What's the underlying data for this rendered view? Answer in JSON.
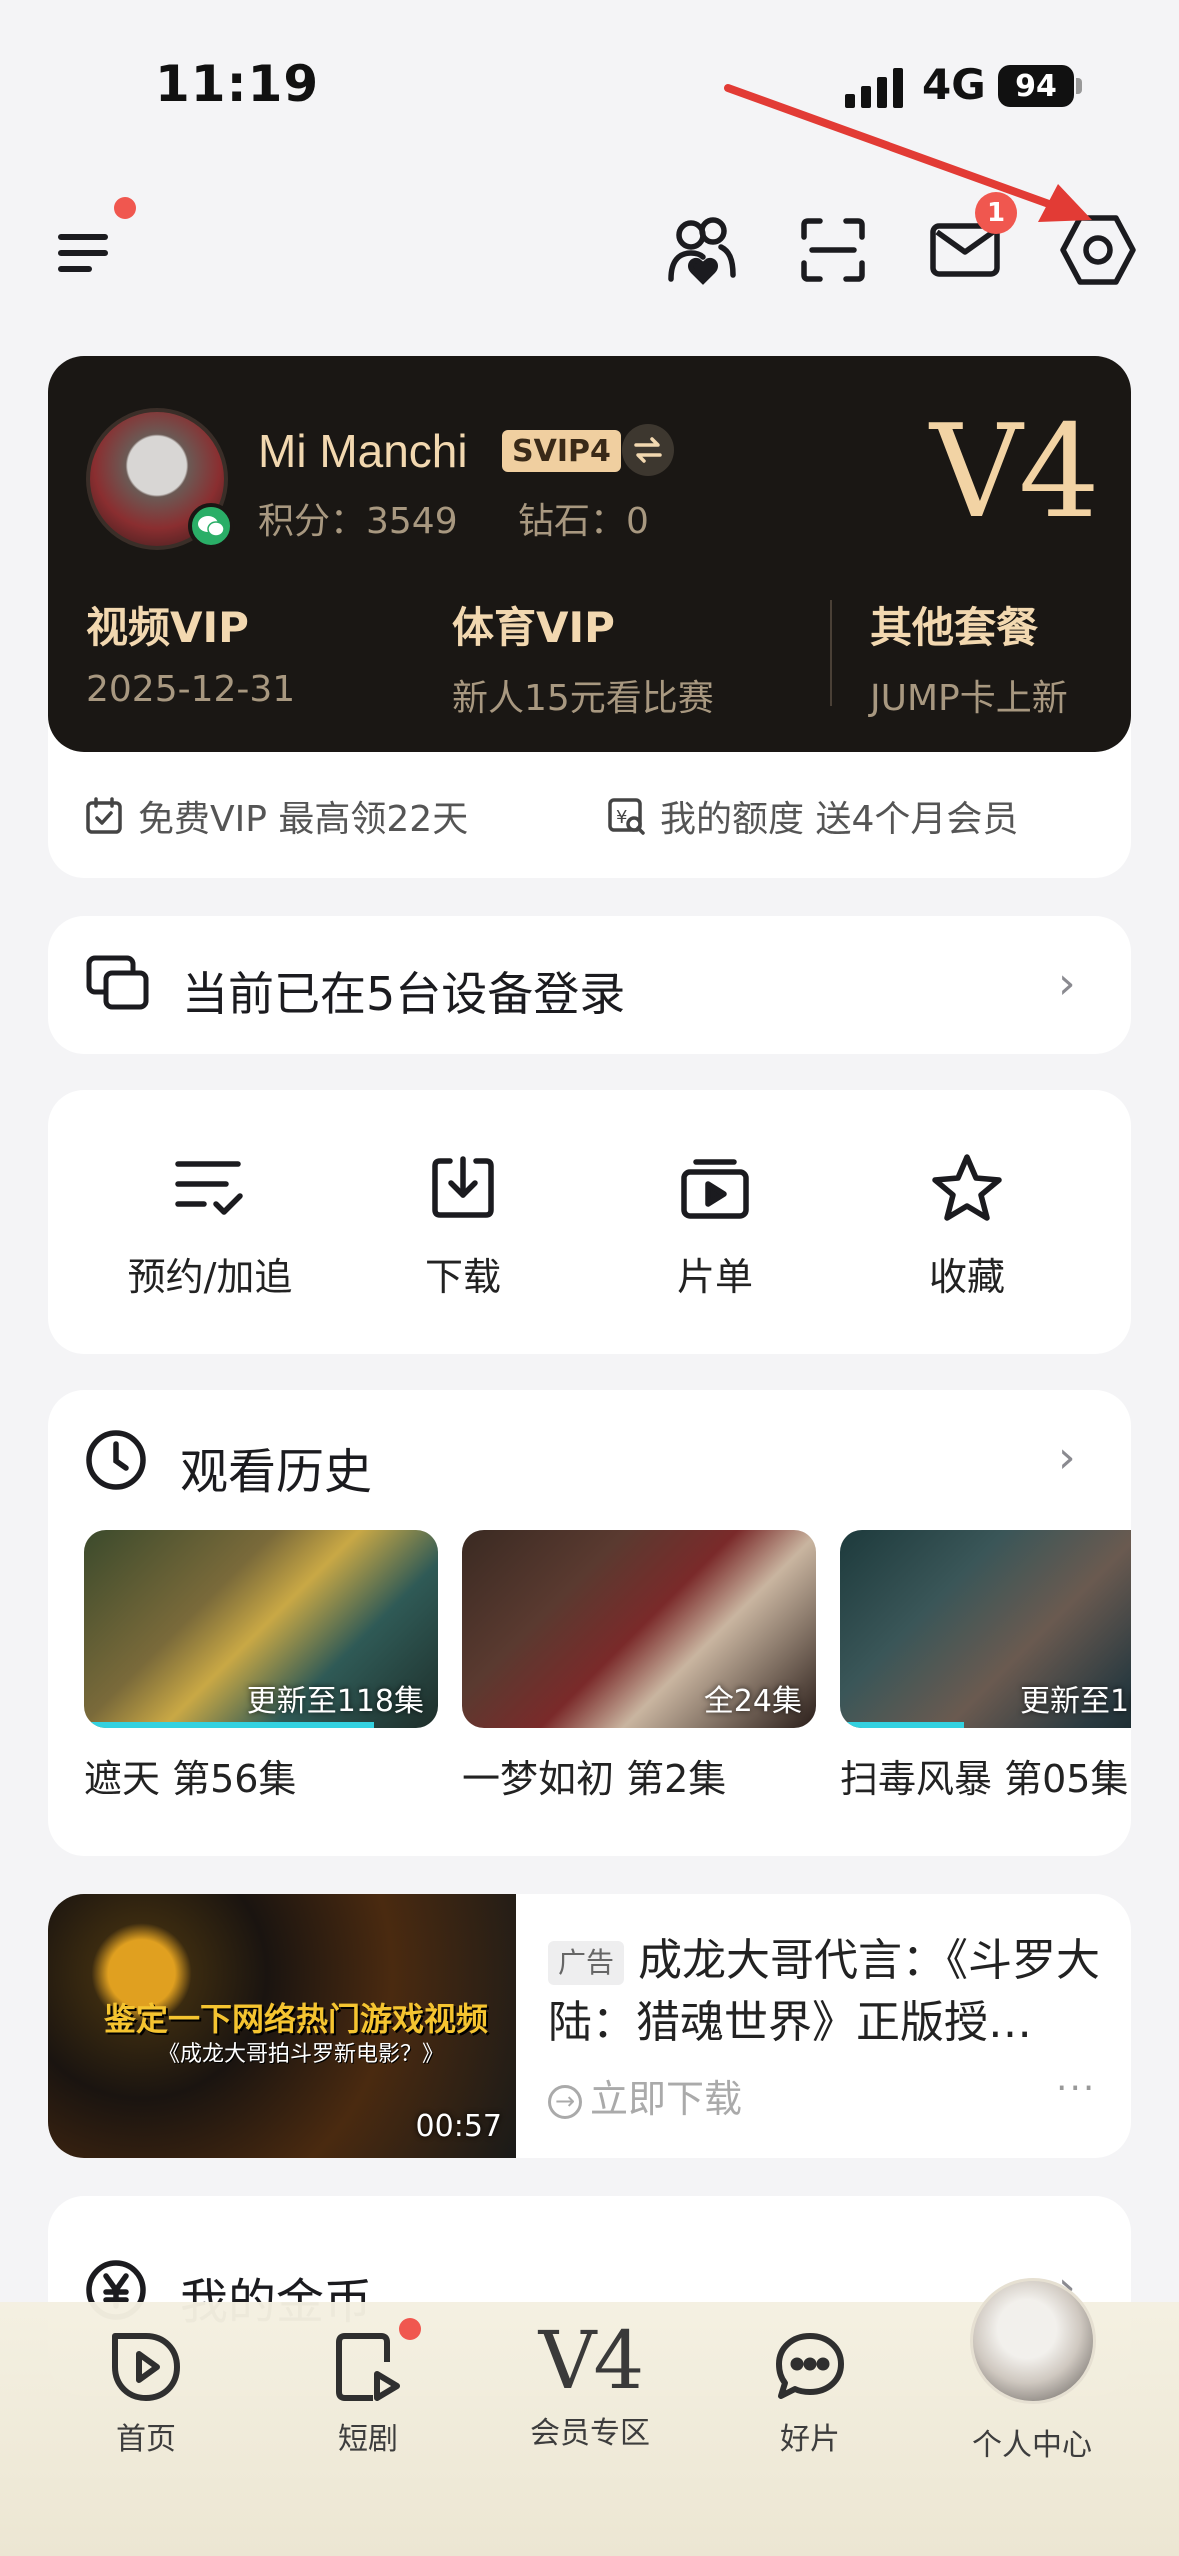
{
  "status_bar": {
    "time": "11:19",
    "network": "4G",
    "battery": "94"
  },
  "toolbar": {
    "messages_badge": "1"
  },
  "vip_card": {
    "user_name": "Mi Manchi",
    "vip_tag": "SVIP4",
    "points": "积分：3549",
    "diamonds": "钻石：0",
    "level": "V4",
    "plans": [
      {
        "title": "视频VIP",
        "subtitle": "2025-12-31"
      },
      {
        "title": "体育VIP",
        "subtitle": "新人15元看比赛"
      },
      {
        "title": "其他套餐",
        "subtitle": "JUMP卡上新"
      }
    ],
    "free_vip": "免费VIP 最高领22天",
    "my_quota": "我的额度 送4个月会员"
  },
  "devices": {
    "text": "当前已在5台设备登录"
  },
  "actions": [
    {
      "label": "预约/加追",
      "icon": "checklist-icon"
    },
    {
      "label": "下载",
      "icon": "download-icon"
    },
    {
      "label": "片单",
      "icon": "playlist-icon"
    },
    {
      "label": "收藏",
      "icon": "star-icon"
    }
  ],
  "history": {
    "title": "观看历史",
    "items": [
      {
        "badge": "更新至118集",
        "caption": "遮天 第56集",
        "progress": 0.82
      },
      {
        "badge": "全24集",
        "caption": "一梦如初 第2集",
        "progress": 0.0
      },
      {
        "badge": "更新至1(",
        "caption": "扫毒风暴 第05集",
        "progress": 0.35
      }
    ]
  },
  "ad": {
    "tag": "广告",
    "title": "成龙大哥代言：《斗罗大陆：猎魂世界》正版授…",
    "download": "立即下载",
    "more": "···",
    "image_headline": "鉴定一下网络热门游戏视频",
    "image_sub": "《成龙大哥拍斗罗新电影？》",
    "duration": "00:57"
  },
  "coins": {
    "title": "我的金币"
  },
  "bottom_nav": [
    {
      "label": "首页"
    },
    {
      "label": "短剧"
    },
    {
      "label": "会员专区",
      "glyph": "V4"
    },
    {
      "label": "好片"
    },
    {
      "label": "个人中心"
    }
  ]
}
